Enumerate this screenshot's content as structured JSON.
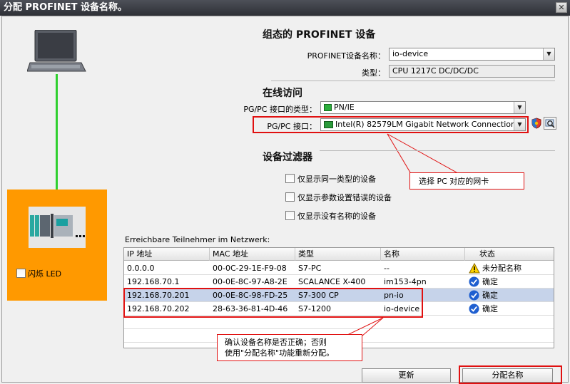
{
  "window": {
    "title": "分配 PROFINET 设备名称。",
    "close_glyph": "✕"
  },
  "configured": {
    "heading": "组态的 PROFINET 设备",
    "name_label": "PROFINET设备名称：",
    "name_value": "io-device",
    "type_label": "类型：",
    "type_value": "CPU 1217C DC/DC/DC"
  },
  "online": {
    "heading": "在线访问",
    "if_type_label": "PG/PC 接口的类型：",
    "if_type_value": "PN/IE",
    "if_label": "PG/PC 接口：",
    "if_value": "Intel(R) 82579LM Gigabit Network Connection"
  },
  "filter": {
    "heading": "设备过滤器",
    "options": [
      "仅显示同一类型的设备",
      "仅显示参数设置错误的设备",
      "仅显示没有名称的设备"
    ]
  },
  "left": {
    "flash_led_label": "闪烁 LED"
  },
  "callouts": {
    "nic": "选择 PC 对应的网卡",
    "confirm_line1": "确认设备名称是否正确；否则",
    "confirm_line2": "使用\"分配名称\"功能重新分配。"
  },
  "table": {
    "caption": "Erreichbare Teilnehmer im Netzwerk:",
    "columns": [
      "IP 地址",
      "MAC 地址",
      "类型",
      "名称",
      "状态"
    ],
    "rows": [
      {
        "ip": "0.0.0.0",
        "mac": "00-0C-29-1E-F9-08",
        "type": "S7-PC",
        "name": "--",
        "status": "未分配名称",
        "status_icon": "warning-icon"
      },
      {
        "ip": "192.168.70.1",
        "mac": "00-0E-8C-97-A8-2E",
        "type": "SCALANCE X-400",
        "name": "im153-4pn",
        "status": "确定",
        "status_icon": "ok-check-icon"
      },
      {
        "ip": "192.168.70.201",
        "mac": "00-0E-8C-98-FD-25",
        "type": "S7-300 CP",
        "name": "pn-io",
        "status": "确定",
        "status_icon": "ok-check-icon"
      },
      {
        "ip": "192.168.70.202",
        "mac": "28-63-36-81-4D-46",
        "type": "S7-1200",
        "name": "io-device",
        "status": "确定",
        "status_icon": "ok-check-icon"
      }
    ],
    "selected_row": 2
  },
  "buttons": {
    "refresh": "更新",
    "assign": "分配名称"
  },
  "colors": {
    "accent_red": "#e01010",
    "orange": "#ff9900",
    "link_green": "#2fd02f",
    "selection": "#c6d3ea"
  }
}
